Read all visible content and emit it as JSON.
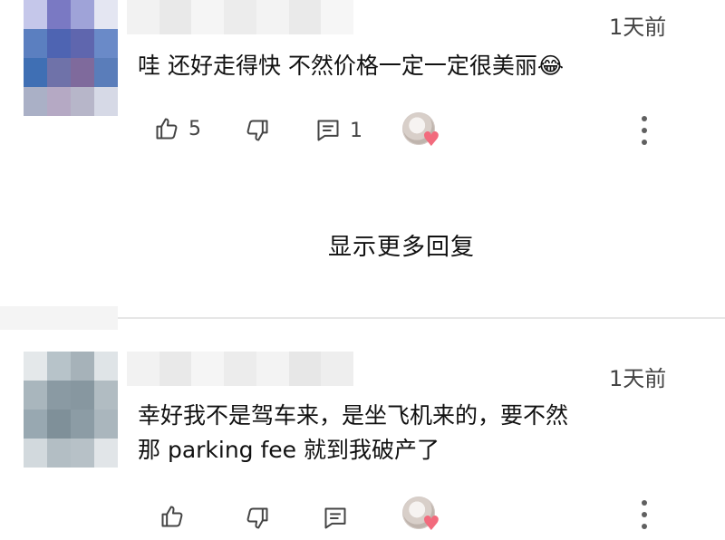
{
  "comments": [
    {
      "time": "1天前",
      "text_lines": [
        "哇 还好走得快 不然价格一定一定很美丽😂"
      ],
      "like_count": "5",
      "reply_count": "1",
      "avatar_pixels": [
        "#c5c7ea",
        "#7a79c3",
        "#9fa3d8",
        "#e4e6f2",
        "#5b7fc0",
        "#4e64b2",
        "#5f66ae",
        "#6a8ac8",
        "#3f6fb4",
        "#6f72a9",
        "#7f6a9c",
        "#5a7dba",
        "#aab0c6",
        "#b5a9c4",
        "#b7b6c9",
        "#d6d9e6"
      ]
    },
    {
      "time": "1天前",
      "text_lines": [
        "幸好我不是驾车来，是坐飞机来的，要不然",
        "那 parking fee 就到我破产了"
      ],
      "like_count": "",
      "reply_count": "",
      "avatar_pixels": [
        "#e4e8ea",
        "#b7c3c9",
        "#a6b2b9",
        "#dfe4e7",
        "#a9b6bd",
        "#8a9aa3",
        "#8797a0",
        "#b1bcc2",
        "#98a8b1",
        "#7f9099",
        "#8c9ca5",
        "#aab6bd",
        "#d2d9dd",
        "#b3bec4",
        "#b7c1c7",
        "#e1e5e8"
      ]
    }
  ],
  "show_more_replies": "显示更多回复",
  "icons": {
    "like": "thumbs-up-icon",
    "dislike": "thumbs-down-icon",
    "reply": "comment-icon",
    "more": "more-vertical-icon",
    "heart": "heart-icon"
  },
  "colors": {
    "heart": "#f26b7d",
    "icon": "#444444",
    "divider": "#e6e6e6"
  }
}
